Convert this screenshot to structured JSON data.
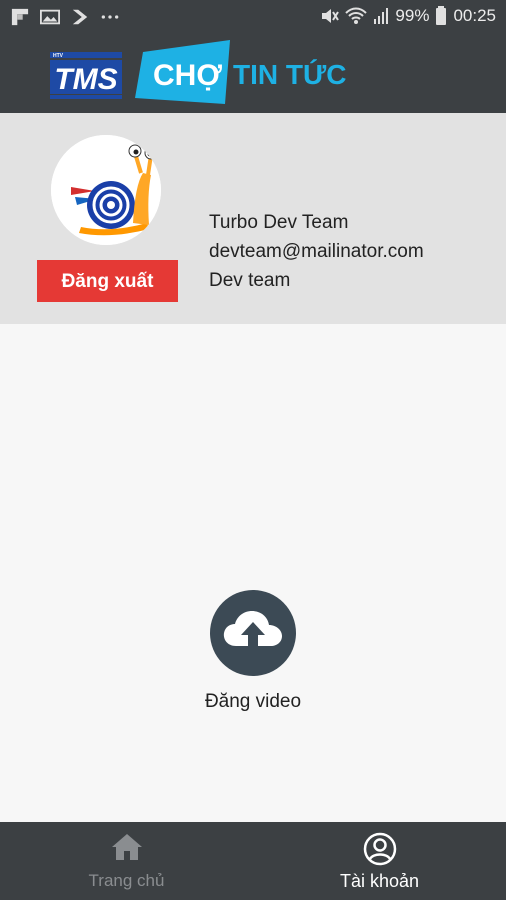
{
  "status_bar": {
    "battery": "99%",
    "time": "00:25",
    "icons": [
      "flipboard-icon",
      "gallery-icon",
      "check-icon",
      "more-dots-icon",
      "mute-icon",
      "wifi-icon",
      "signal-icon",
      "battery-icon"
    ]
  },
  "header": {
    "logo_tms_text": "TMS",
    "logo_htv_text": "HTV",
    "logo_cho_text": "CHỢ",
    "logo_tintuc_text": "TIN TỨC",
    "colors": {
      "background": "#3c4043",
      "tms_blue": "#1e4aa5",
      "cyan": "#1eb1e4"
    }
  },
  "profile": {
    "name": "Turbo Dev Team",
    "email": "devteam@mailinator.com",
    "team": "Dev team",
    "logout_label": "Đăng xuất",
    "avatar_icon": "snail-avatar",
    "colors": {
      "background": "#e2e2e2",
      "logout": "#e53935"
    }
  },
  "upload": {
    "label": "Đăng video",
    "icon": "cloud-upload-icon"
  },
  "bottom_nav": {
    "items": [
      {
        "label": "Trang chủ",
        "icon": "home-icon",
        "active": false
      },
      {
        "label": "Tài khoản",
        "icon": "account-icon",
        "active": true
      }
    ]
  }
}
